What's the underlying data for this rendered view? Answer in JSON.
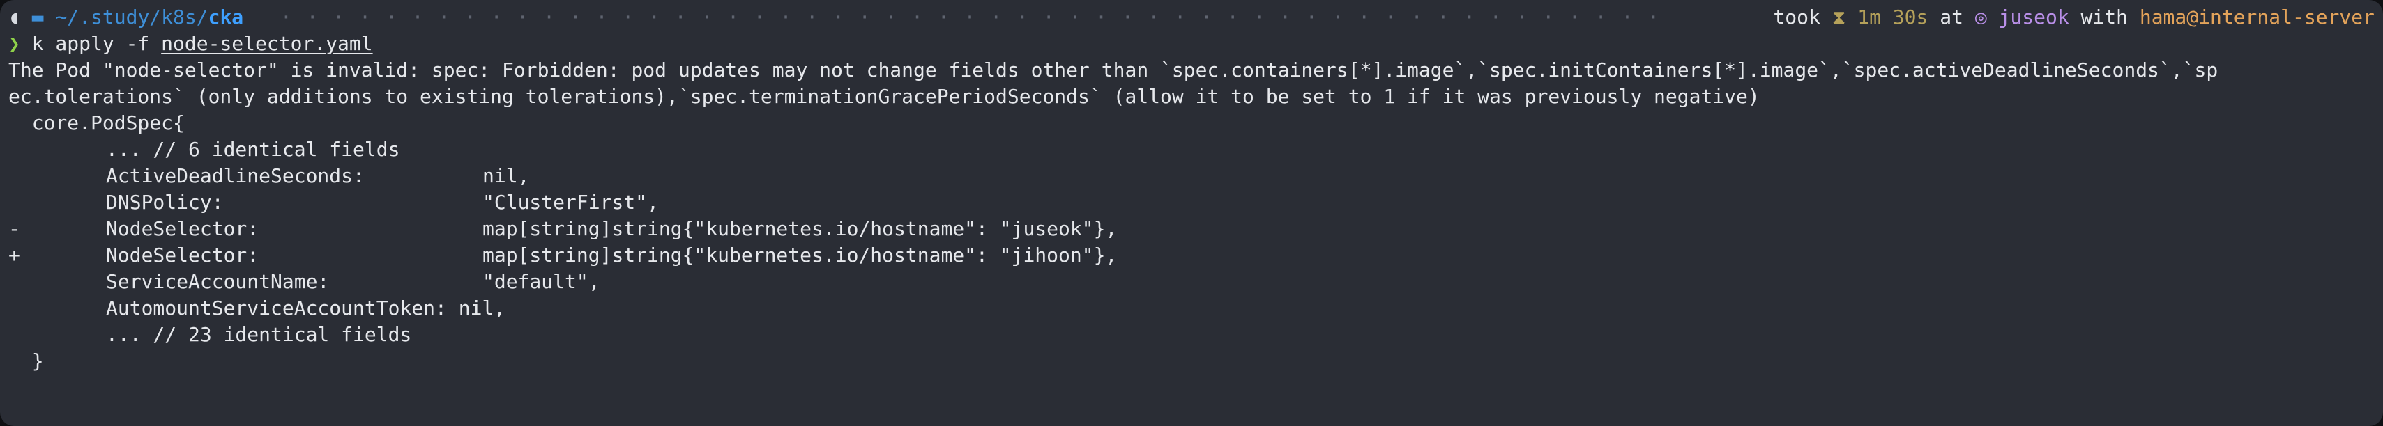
{
  "prompt": {
    "os_glyph": "◖",
    "folder_glyph": "▬",
    "path_prefix": "~/.study/k8s/",
    "path_current": "cka",
    "took_label": "took",
    "hourglass_glyph": "⧗",
    "duration": "1m 30s",
    "at_label": "at",
    "user_glyph": "◎",
    "user": "juseok",
    "with_label": "with",
    "host": "hama@internal-server",
    "dots": "· · · · · · · · · · · · · · · · · · · · · · · · · · · · · · · · · · · · · · · · · · · · · · · · · · · · · · · · · · · · · · · · · · · · · · · · · · · · · · · · · · · · · · · · · · · · · · · · · · · · · · · · · · · · · · · · · · · · · · · · ·"
  },
  "command": {
    "arrow": "❯",
    "name": "k apply -f ",
    "file": "node-selector.yaml"
  },
  "error": {
    "line1": "The Pod \"node-selector\" is invalid: spec: Forbidden: pod updates may not change fields other than `spec.containers[*].image`,`spec.initContainers[*].image`,`spec.activeDeadlineSeconds`,`sp",
    "line2": "ec.tolerations` (only additions to existing tolerations),`spec.terminationGracePeriodSeconds` (allow it to be set to 1 if it was previously negative)"
  },
  "diff": {
    "open": "  core.PodSpec{",
    "rows": [
      {
        "marker": "",
        "field": "... // 6 identical fields",
        "value": ""
      },
      {
        "marker": "",
        "field": "ActiveDeadlineSeconds:",
        "value": "nil,"
      },
      {
        "marker": "",
        "field": "DNSPolicy:",
        "value": "\"ClusterFirst\","
      },
      {
        "marker": "-",
        "field": "NodeSelector:",
        "value": "map[string]string{\"kubernetes.io/hostname\": \"juseok\"},"
      },
      {
        "marker": "+",
        "field": "NodeSelector:",
        "value": "map[string]string{\"kubernetes.io/hostname\": \"jihoon\"},"
      },
      {
        "marker": "",
        "field": "ServiceAccountName:",
        "value": "\"default\","
      },
      {
        "marker": "",
        "field": "AutomountServiceAccountToken: nil,",
        "value": ""
      },
      {
        "marker": "",
        "field": "... // 23 identical fields",
        "value": ""
      }
    ],
    "close": "  }"
  }
}
